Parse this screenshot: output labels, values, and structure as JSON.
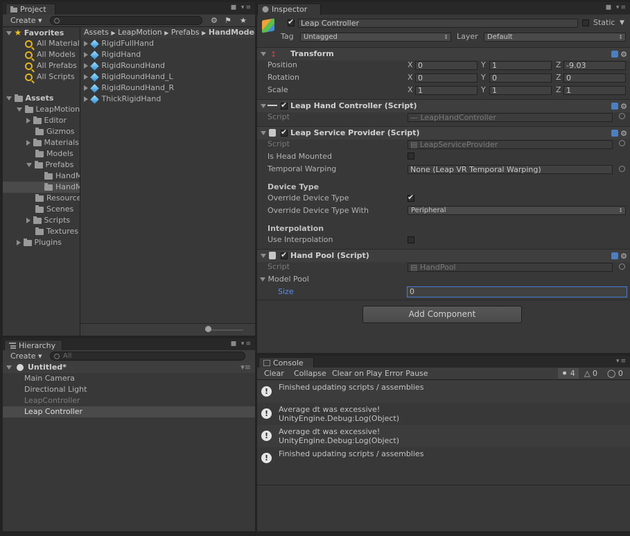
{
  "project": {
    "tab": "Project",
    "create_label": "Create",
    "favorites_label": "Favorites",
    "favorites": [
      "All Materials",
      "All Models",
      "All Prefabs",
      "All Scripts"
    ],
    "assets_label": "Assets",
    "tree": {
      "leapmotion": "LeapMotion",
      "editor": "Editor",
      "gizmos": "Gizmos",
      "materials": "Materials",
      "models": "Models",
      "prefabs": "Prefabs",
      "handm1": "HandModels",
      "handm2": "HandModelsNonHuman",
      "resources": "Resources",
      "scenes": "Scenes",
      "scripts": "Scripts",
      "textures": "Textures",
      "plugins": "Plugins"
    },
    "breadcrumb": [
      "Assets",
      "LeapMotion",
      "Prefabs",
      "HandModels"
    ],
    "files": [
      "RigidFullHand",
      "RigidHand",
      "RigidRoundHand",
      "RigidRoundHand_L",
      "RigidRoundHand_R",
      "ThickRigidHand"
    ]
  },
  "hierarchy": {
    "tab": "Hierarchy",
    "create_label": "Create",
    "search_placeholder": "All",
    "scene": "Untitled*",
    "items": [
      "Main Camera",
      "Directional Light",
      "LeapController",
      "Leap Controller"
    ]
  },
  "inspector": {
    "tab": "Inspector",
    "object_name": "Leap Controller",
    "static_label": "Static",
    "tag_label": "Tag",
    "tag_value": "Untagged",
    "layer_label": "Layer",
    "layer_value": "Default",
    "transform": {
      "title": "Transform",
      "position_label": "Position",
      "rotation_label": "Rotation",
      "scale_label": "Scale",
      "position": [
        "0",
        "1",
        "-9.03"
      ],
      "rotation": [
        "0",
        "0",
        "0"
      ],
      "scale": [
        "1",
        "1",
        "1"
      ],
      "axis_x": "X",
      "axis_y": "Y",
      "axis_z": "Z"
    },
    "hand_controller": {
      "title": "Leap Hand Controller (Script)",
      "script_label": "Script",
      "script_value": "LeapHandController"
    },
    "service_provider": {
      "title": "Leap Service Provider (Script)",
      "script_label": "Script",
      "script_value": "LeapServiceProvider",
      "head_mounted_label": "Is Head Mounted",
      "temporal_label": "Temporal Warping",
      "temporal_value": "None (Leap VR Temporal Warping)",
      "device_type_header": "Device Type",
      "override_label": "Override Device Type",
      "override_with_label": "Override Device Type With",
      "override_with_value": "Peripheral",
      "interpolation_header": "Interpolation",
      "use_interp_label": "Use Interpolation"
    },
    "hand_pool": {
      "title": "Hand Pool (Script)",
      "script_label": "Script",
      "script_value": "HandPool",
      "model_pool_label": "Model Pool",
      "size_label": "Size",
      "size_value": "0"
    },
    "add_component": "Add Component"
  },
  "console": {
    "tab": "Console",
    "clear": "Clear",
    "collapse": "Collapse",
    "clear_on_play": "Clear on Play",
    "error_pause": "Error Pause",
    "count_info": "4",
    "count_warn": "0",
    "count_err": "0",
    "messages": [
      {
        "line1": "Finished updating scripts / assemblies",
        "line2": ""
      },
      {
        "line1": "Average dt was excessive!",
        "line2": "UnityEngine.Debug:Log(Object)"
      },
      {
        "line1": "Average dt was excessive!",
        "line2": "UnityEngine.Debug:Log(Object)"
      },
      {
        "line1": "Finished updating scripts / assemblies",
        "line2": ""
      }
    ]
  }
}
